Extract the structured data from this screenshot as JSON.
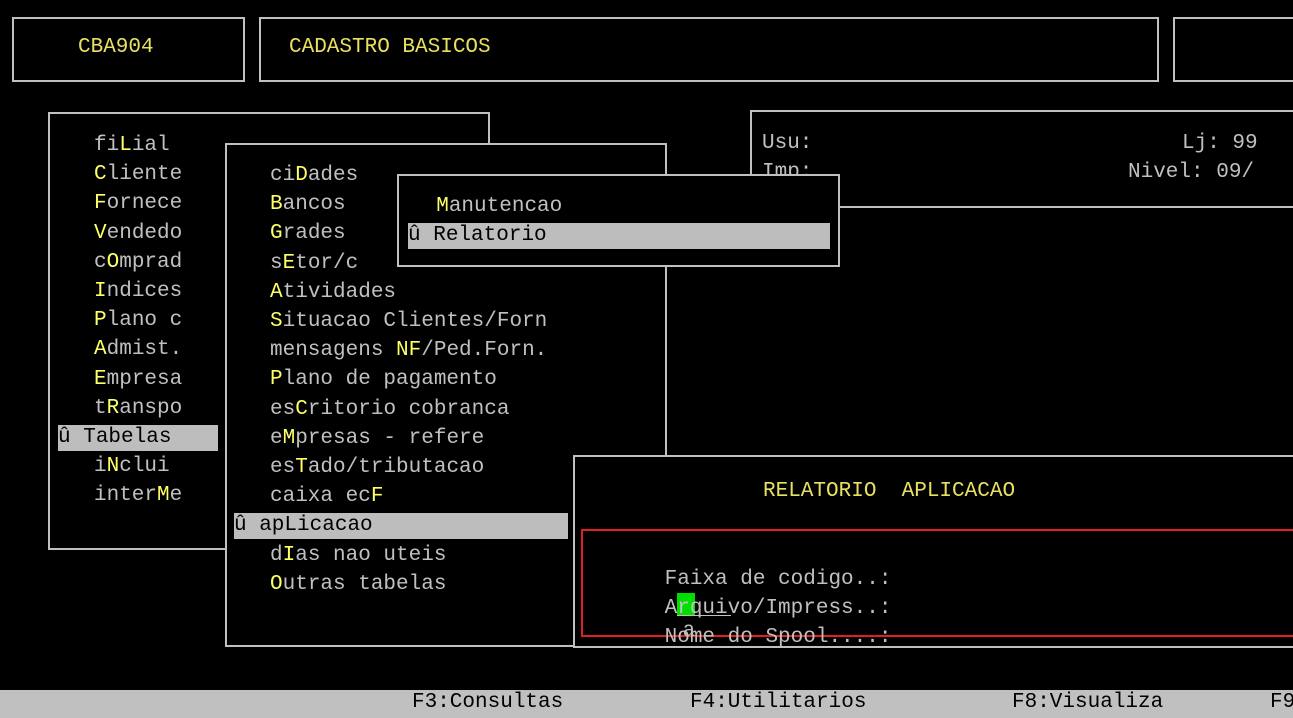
{
  "header": {
    "program_code": "CBA904",
    "title": "CADASTRO BASICOS"
  },
  "info": {
    "usu_label": "Usu:",
    "imp_label": "Imp:",
    "lj_label": "Lj: 99",
    "nivel_label": "Nivel: 09/"
  },
  "menu1": {
    "items": [
      {
        "pre": "fi",
        "hot": "L",
        "post": "ial"
      },
      {
        "pre": "",
        "hot": "C",
        "post": "liente"
      },
      {
        "pre": "",
        "hot": "F",
        "post": "ornece"
      },
      {
        "pre": "",
        "hot": "V",
        "post": "endedo"
      },
      {
        "pre": "c",
        "hot": "O",
        "post": "mprad"
      },
      {
        "pre": "",
        "hot": "I",
        "post": "ndices"
      },
      {
        "pre": "",
        "hot": "P",
        "post": "lano c"
      },
      {
        "pre": "",
        "hot": "A",
        "post": "dmist."
      },
      {
        "pre": "",
        "hot": "E",
        "post": "mpresa"
      },
      {
        "pre": "t",
        "hot": "R",
        "post": "anspo"
      },
      {
        "pre": "û ",
        "hot": "T",
        "post": "abelas"
      },
      {
        "pre": "i",
        "hot": "N",
        "post": "clui"
      },
      {
        "pre": "inter",
        "hot": "M",
        "post": "e"
      }
    ]
  },
  "menu2": {
    "items": [
      {
        "pre": "ci",
        "hot": "D",
        "post": "ades"
      },
      {
        "pre": "",
        "hot": "B",
        "post": "ancos"
      },
      {
        "pre": "",
        "hot": "G",
        "post": "rades"
      },
      {
        "pre": "s",
        "hot": "E",
        "post": "tor/c"
      },
      {
        "pre": "",
        "hot": "A",
        "post": "tividades"
      },
      {
        "pre": "",
        "hot": "S",
        "post": "ituacao Clientes/Forn"
      },
      {
        "pre": "mensagens ",
        "hot": "NF",
        "post": "/Ped.Forn."
      },
      {
        "pre": "",
        "hot": "P",
        "post": "lano de pagamento"
      },
      {
        "pre": "es",
        "hot": "C",
        "post": "ritorio cobranca"
      },
      {
        "pre": "e",
        "hot": "M",
        "post": "presas - refere"
      },
      {
        "pre": "es",
        "hot": "T",
        "post": "ado/tributacao"
      },
      {
        "pre": "caixa ec",
        "hot": "F",
        "post": ""
      },
      {
        "pre": "û ap",
        "hot": "L",
        "post": "icacao"
      },
      {
        "pre": "d",
        "hot": "I",
        "post": "as nao uteis"
      },
      {
        "pre": "",
        "hot": "O",
        "post": "utras tabelas"
      }
    ]
  },
  "menu3": {
    "items": [
      {
        "pre": "  ",
        "hot": "M",
        "post": "anutencao"
      },
      {
        "pre": "û ",
        "hot": "R",
        "post": "elatorio"
      }
    ]
  },
  "report": {
    "title": "RELATORIO  APLICACAO",
    "field1_label": "Faixa de codigo..:",
    "field1_sep": "a",
    "field2_label": "Arquivo/Impress..:",
    "field3_label": "Nome do Spool....:"
  },
  "statusbar": {
    "f3": "F3:Consultas",
    "f4": "F4:Utilitarios",
    "f8": "F8:Visualiza",
    "f9": "F9"
  },
  "colors": {
    "background": "#000000",
    "text": "#c0c0c0",
    "hotkey": "#ffff66",
    "title": "#e8e060",
    "highlight": "#bdbdbd",
    "cursor": "#00e000",
    "form_border": "#e02020"
  }
}
